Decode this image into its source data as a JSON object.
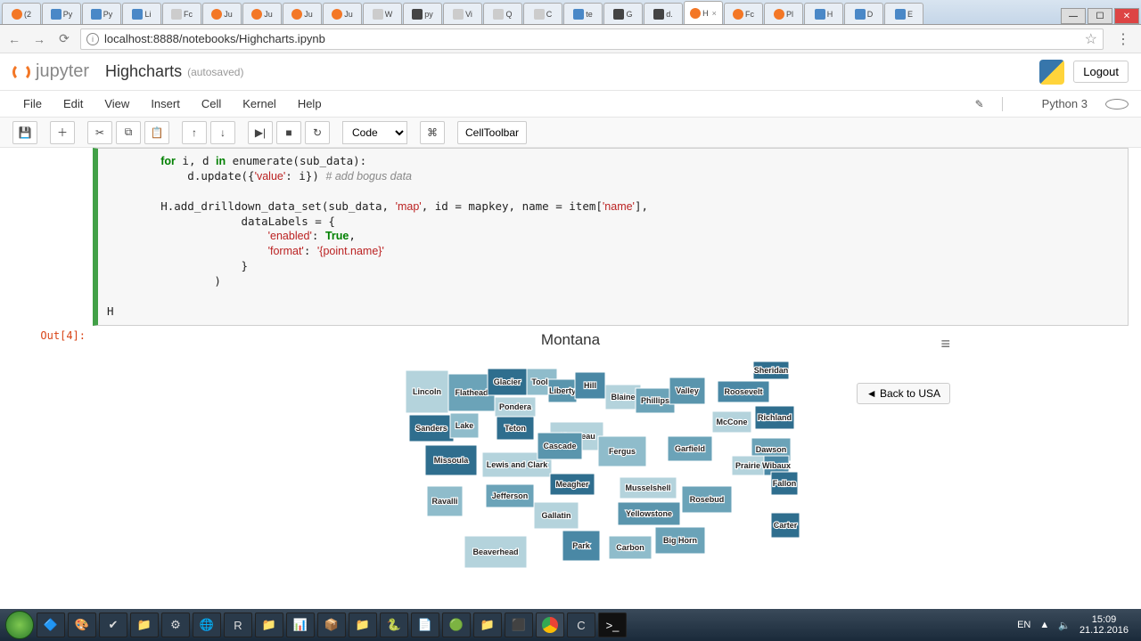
{
  "browser": {
    "tabs": [
      "(2",
      "Py",
      "Py",
      "Li",
      "Fc",
      "Ju",
      "Ju",
      "Ju",
      "Ju",
      "W",
      "py",
      "Vi",
      "Q",
      "C",
      "te",
      "G",
      "d.",
      "H",
      "Fc",
      "Pl",
      "H",
      "D",
      "E"
    ],
    "active_tab": 17,
    "url": "localhost:8888/notebooks/Highcharts.ipynb"
  },
  "jupyter": {
    "brand": "jupyter",
    "title": "Highcharts",
    "autosave": "(autosaved)",
    "logout": "Logout",
    "menu": [
      "File",
      "Edit",
      "View",
      "Insert",
      "Cell",
      "Kernel",
      "Help"
    ],
    "kernel": "Python 3",
    "cell_type": "Code",
    "celltoolbar": "CellToolbar",
    "out_prompt": "Out[4]:"
  },
  "code": "        for i, d in enumerate(sub_data):\n            d.update({'value': i}) # add bogus data\n\n        H.add_drilldown_data_set(sub_data, 'map', id = mapkey, name = item['name'],\n                    dataLabels = {\n                        'enabled': True,\n                        'format': '{point.name}'\n                    }\n                )\n\nH",
  "chart": {
    "title": "Montana",
    "back": "◄ Back to USA",
    "menu": "≡"
  },
  "chart_data": {
    "type": "map",
    "title": "Montana",
    "region": "Montana counties",
    "note": "Choropleth of Montana counties; fill shade varies by index value (bogus data). Labels show county names.",
    "counties": [
      "Lincoln",
      "Flathead",
      "Glacier",
      "Toole",
      "Liberty",
      "Hill",
      "Blaine",
      "Phillips",
      "Valley",
      "Sheridan",
      "Roosevelt",
      "Sanders",
      "Lake",
      "Pondera",
      "Teton",
      "Chouteau",
      "Richland",
      "McCone",
      "Dawson",
      "Missoula",
      "Lewis and Clark",
      "Cascade",
      "Fergus",
      "Garfield",
      "Prairie",
      "Wibaux",
      "Ravalli",
      "Jefferson",
      "Meagher",
      "Musselshell",
      "Rosebud",
      "Fallon",
      "Gallatin",
      "Yellowstone",
      "Big Horn",
      "Carter",
      "Beaverhead",
      "Park",
      "Carbon"
    ]
  },
  "taskbar": {
    "lang": "EN",
    "time": "15:09",
    "date": "21.12.2016"
  }
}
